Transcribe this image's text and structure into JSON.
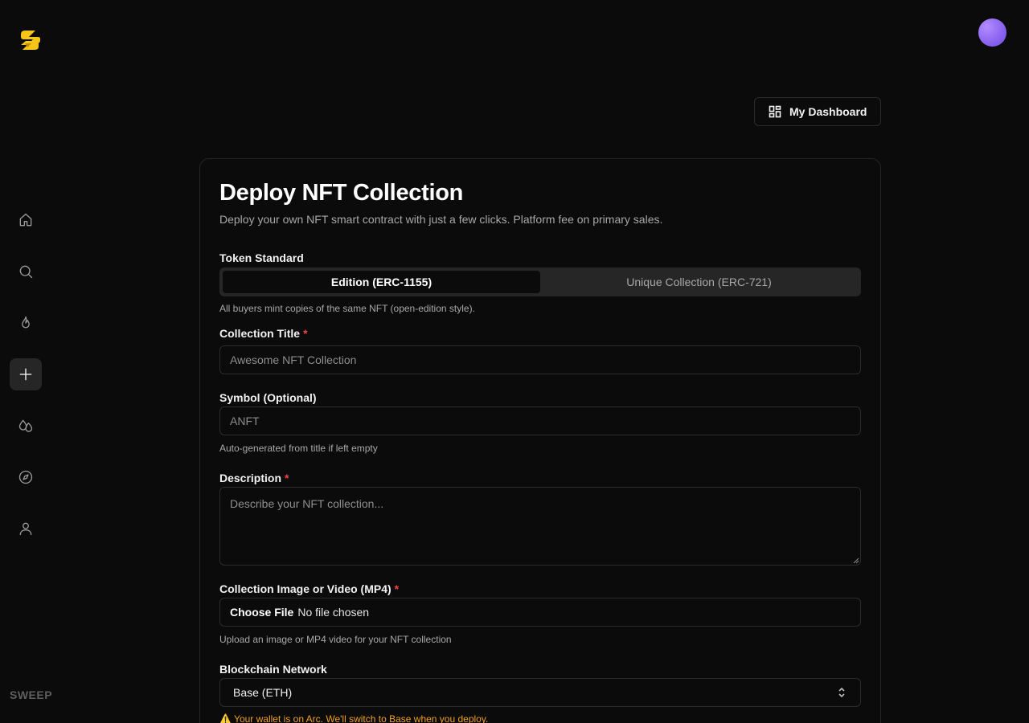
{
  "sidebar": {
    "brand": "SWEEP",
    "items": [
      {
        "icon": "home-icon",
        "name": "sidebar-item-home"
      },
      {
        "icon": "search-icon",
        "name": "sidebar-item-search"
      },
      {
        "icon": "flame-icon",
        "name": "sidebar-item-trending"
      },
      {
        "icon": "plus-icon",
        "name": "sidebar-item-create"
      },
      {
        "icon": "drops-icon",
        "name": "sidebar-item-drops"
      },
      {
        "icon": "compass-icon",
        "name": "sidebar-item-explore"
      },
      {
        "icon": "user-icon",
        "name": "sidebar-item-profile"
      }
    ]
  },
  "header": {
    "dashboard_label": "My Dashboard"
  },
  "form": {
    "title": "Deploy NFT Collection",
    "subtitle": "Deploy your own NFT smart contract with just a few clicks. Platform fee on primary sales.",
    "token_standard": {
      "label": "Token Standard",
      "options": [
        "Edition (ERC-1155)",
        "Unique Collection (ERC-721)"
      ],
      "selected": "Edition (ERC-1155)",
      "hint": "All buyers mint copies of the same NFT (open-edition style)."
    },
    "collection_title": {
      "label": "Collection Title",
      "required_mark": "*",
      "placeholder": "Awesome NFT Collection",
      "value": ""
    },
    "symbol": {
      "label": "Symbol (Optional)",
      "placeholder": "ANFT",
      "value": "",
      "hint": "Auto-generated from title if left empty"
    },
    "description": {
      "label": "Description",
      "required_mark": "*",
      "placeholder": "Describe your NFT collection...",
      "value": ""
    },
    "media": {
      "label": "Collection Image or Video (MP4)",
      "required_mark": "*",
      "button_label": "Choose File",
      "status": "No file chosen",
      "hint": "Upload an image or MP4 video for your NFT collection"
    },
    "network": {
      "label": "Blockchain Network",
      "selected": "Base (ETH)",
      "warning": "⚠️ Your wallet is on Arc. We'll switch to Base when you deploy."
    }
  },
  "colors": {
    "background": "#0b0b0b",
    "border": "#2c2c2c",
    "required": "#ef4444",
    "warning": "#f0a020",
    "avatar": "#8a63f0"
  }
}
